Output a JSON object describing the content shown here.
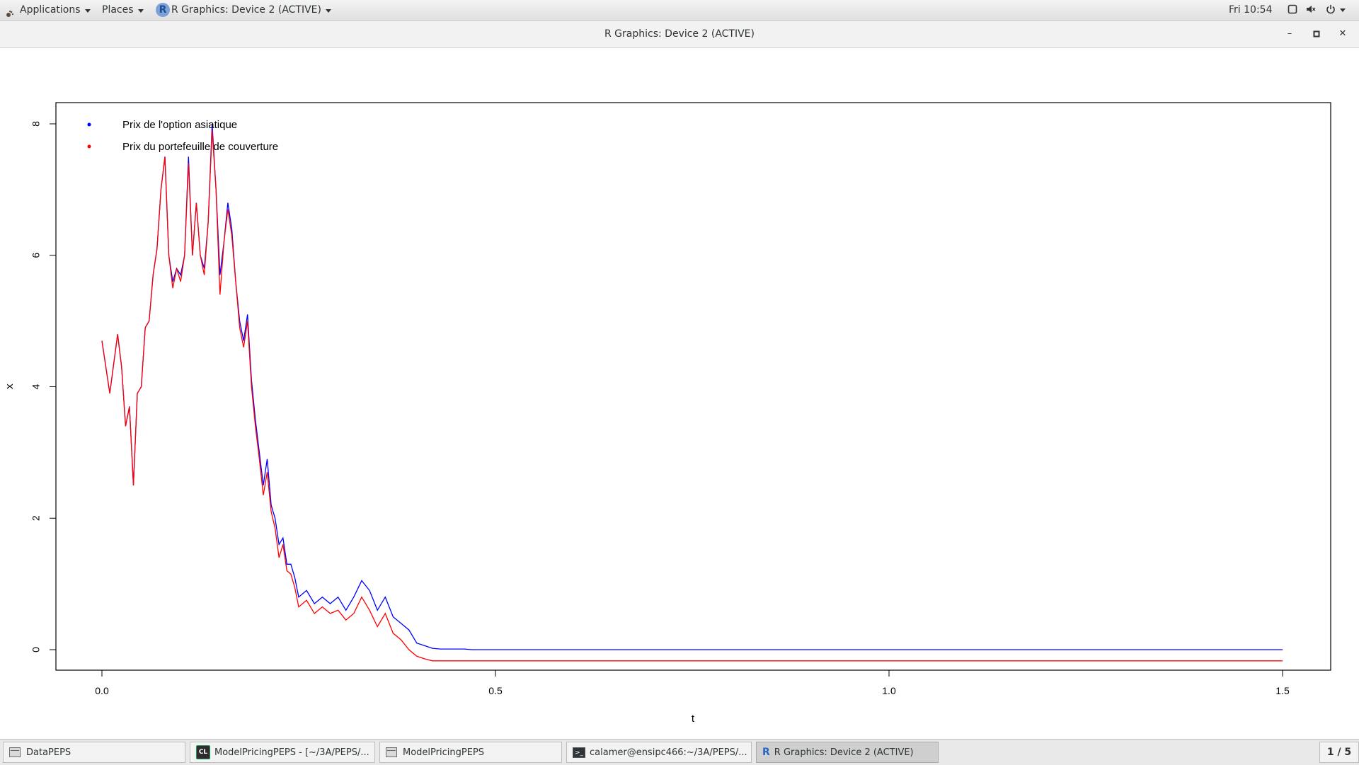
{
  "topbar": {
    "applications": "Applications",
    "places": "Places",
    "active_app": "R Graphics: Device 2 (ACTIVE)",
    "clock": "Fri 10:54"
  },
  "window": {
    "title": "R Graphics: Device 2 (ACTIVE)"
  },
  "chart_data": {
    "type": "line",
    "xlabel": "t",
    "ylabel": "x",
    "xlim": [
      0,
      1.5
    ],
    "ylim": [
      0,
      8
    ],
    "xticks": [
      "0.0",
      "0.5",
      "1.0",
      "1.5"
    ],
    "yticks": [
      "0",
      "2",
      "4",
      "6",
      "8"
    ],
    "legend_position": "top-left",
    "legend": [
      {
        "label": "Prix de l'option asiatique",
        "color": "#0000ff"
      },
      {
        "label": "Prix du portefeuille de couverture",
        "color": "#ff0000"
      }
    ],
    "series": [
      {
        "name": "Prix de l'option asiatique",
        "color": "#0000ff",
        "x": [
          0.0,
          0.01,
          0.02,
          0.025,
          0.03,
          0.035,
          0.04,
          0.045,
          0.05,
          0.055,
          0.06,
          0.065,
          0.07,
          0.075,
          0.08,
          0.085,
          0.09,
          0.095,
          0.1,
          0.105,
          0.11,
          0.115,
          0.12,
          0.125,
          0.13,
          0.135,
          0.14,
          0.145,
          0.15,
          0.155,
          0.16,
          0.165,
          0.17,
          0.175,
          0.18,
          0.185,
          0.19,
          0.195,
          0.2,
          0.205,
          0.21,
          0.215,
          0.22,
          0.225,
          0.23,
          0.235,
          0.24,
          0.245,
          0.25,
          0.26,
          0.27,
          0.28,
          0.29,
          0.3,
          0.31,
          0.32,
          0.33,
          0.34,
          0.35,
          0.36,
          0.37,
          0.38,
          0.39,
          0.4,
          0.41,
          0.42,
          0.43,
          0.44,
          0.45,
          0.46,
          0.47,
          0.48,
          0.49,
          0.5,
          0.51,
          0.52,
          0.53,
          0.54,
          0.55,
          0.56,
          0.57,
          0.58,
          0.6,
          0.65,
          0.7,
          0.75,
          0.8,
          1.0,
          1.2,
          1.5
        ],
        "values": [
          4.7,
          3.9,
          4.8,
          4.3,
          3.4,
          3.7,
          2.5,
          3.9,
          4.0,
          4.9,
          5.0,
          5.7,
          6.1,
          7.0,
          7.5,
          6.0,
          5.6,
          5.8,
          5.7,
          6.0,
          7.5,
          6.0,
          6.8,
          6.0,
          5.8,
          6.5,
          8.0,
          7.0,
          5.7,
          6.2,
          6.8,
          6.4,
          5.6,
          5.0,
          4.7,
          5.1,
          4.1,
          3.5,
          3.0,
          2.5,
          2.9,
          2.2,
          2.0,
          1.6,
          1.7,
          1.3,
          1.3,
          1.1,
          0.8,
          0.9,
          0.7,
          0.8,
          0.7,
          0.8,
          0.6,
          0.8,
          1.05,
          0.9,
          0.6,
          0.8,
          0.5,
          0.4,
          0.3,
          0.1,
          0.06,
          0.02,
          0.01,
          0.01,
          0.01,
          0.01,
          0.0,
          0.0,
          0.0,
          0.0,
          0.0,
          0.0,
          0.0,
          0.0,
          0.0,
          0.0,
          0.0,
          0.0,
          0.0,
          0.0,
          0.0,
          0.0,
          0.0,
          0.0,
          0.0,
          0.0
        ]
      },
      {
        "name": "Prix du portefeuille de couverture",
        "color": "#ff0000",
        "x": [
          0.0,
          0.01,
          0.02,
          0.025,
          0.03,
          0.035,
          0.04,
          0.045,
          0.05,
          0.055,
          0.06,
          0.065,
          0.07,
          0.075,
          0.08,
          0.085,
          0.09,
          0.095,
          0.1,
          0.105,
          0.11,
          0.115,
          0.12,
          0.125,
          0.13,
          0.135,
          0.14,
          0.145,
          0.15,
          0.155,
          0.16,
          0.165,
          0.17,
          0.175,
          0.18,
          0.185,
          0.19,
          0.195,
          0.2,
          0.205,
          0.21,
          0.215,
          0.22,
          0.225,
          0.23,
          0.235,
          0.24,
          0.245,
          0.25,
          0.26,
          0.27,
          0.28,
          0.29,
          0.3,
          0.31,
          0.32,
          0.33,
          0.34,
          0.35,
          0.36,
          0.37,
          0.38,
          0.39,
          0.4,
          0.41,
          0.42,
          0.43,
          0.44,
          0.45,
          0.46,
          0.47,
          0.48,
          0.49,
          0.5,
          0.51,
          0.52,
          0.53,
          0.54,
          0.55,
          0.56,
          0.57,
          0.58,
          0.6,
          0.65,
          0.7,
          0.75,
          0.8,
          1.0,
          1.2,
          1.5
        ],
        "values": [
          4.7,
          3.9,
          4.8,
          4.3,
          3.4,
          3.7,
          2.5,
          3.9,
          4.0,
          4.9,
          5.0,
          5.7,
          6.1,
          7.0,
          7.5,
          6.0,
          5.5,
          5.8,
          5.6,
          6.0,
          7.4,
          6.0,
          6.8,
          6.0,
          5.7,
          6.5,
          7.9,
          7.0,
          5.4,
          6.2,
          6.7,
          6.3,
          5.6,
          4.9,
          4.6,
          5.0,
          4.0,
          3.4,
          2.9,
          2.35,
          2.7,
          2.1,
          1.85,
          1.4,
          1.6,
          1.2,
          1.15,
          0.95,
          0.65,
          0.75,
          0.55,
          0.65,
          0.55,
          0.6,
          0.45,
          0.55,
          0.8,
          0.6,
          0.35,
          0.55,
          0.25,
          0.15,
          0.0,
          -0.1,
          -0.14,
          -0.17,
          -0.17,
          -0.17,
          -0.17,
          -0.17,
          -0.17,
          -0.17,
          -0.17,
          -0.17,
          -0.17,
          -0.17,
          -0.17,
          -0.17,
          -0.17,
          -0.17,
          -0.17,
          -0.17,
          -0.17,
          -0.17,
          -0.17,
          -0.17,
          -0.17,
          -0.17,
          -0.17,
          -0.17
        ]
      }
    ]
  },
  "taskbar": {
    "tasks": [
      {
        "label": "DataPEPS"
      },
      {
        "label": "ModelPricingPEPS - [~/3A/PEPS/..."
      },
      {
        "label": "ModelPricingPEPS"
      },
      {
        "label": "calamer@ensipc466:~/3A/PEPS/..."
      },
      {
        "label": "R Graphics: Device 2 (ACTIVE)"
      }
    ],
    "pager": "1 / 5"
  }
}
